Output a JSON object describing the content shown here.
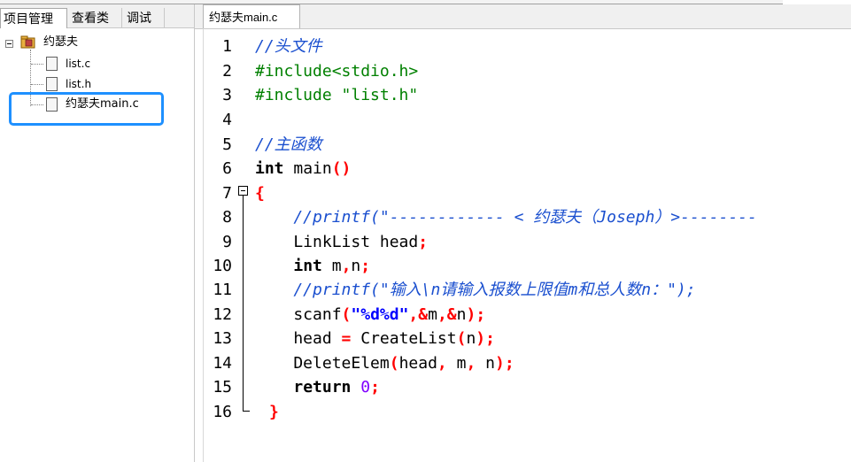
{
  "left_panel": {
    "tabs": [
      {
        "label": "项目管理",
        "active": true
      },
      {
        "label": "查看类",
        "active": false
      },
      {
        "label": "调试",
        "active": false
      }
    ],
    "tree": {
      "project": {
        "label": "约瑟夫",
        "icon": "project-folder-icon"
      },
      "files": [
        {
          "label": "list.c",
          "icon": "file-icon",
          "selected": false
        },
        {
          "label": "list.h",
          "icon": "file-icon",
          "selected": false
        },
        {
          "label": "约瑟夫main.c",
          "icon": "file-icon",
          "selected": true
        }
      ]
    }
  },
  "editor": {
    "tab_label": "约瑟夫main.c",
    "current_line": 16,
    "current_line_color": "#ccffff",
    "highlight_color": "#1e90ff",
    "line_numbers": [
      "1",
      "2",
      "3",
      "4",
      "5",
      "6",
      "7",
      "8",
      "9",
      "10",
      "11",
      "12",
      "13",
      "14",
      "15",
      "16"
    ],
    "code": {
      "l1": "//头文件",
      "l2": "#include<stdio.h>",
      "l3": "#include \"list.h\"",
      "l4": "",
      "l5": "//主函数",
      "l6_kw": "int",
      "l6_rest": " main",
      "l6_paren": "()",
      "l7": "{",
      "l8": "    //printf(\"------------ < 约瑟夫（Joseph）>--------",
      "l9_a": "    LinkList head",
      "l9_b": ";",
      "l10_kw": "int",
      "l10_rest": " m",
      "l10_comma": ",",
      "l10_n": "n",
      "l10_semi": ";",
      "l11": "    //printf(\"输入\\n请输入报数上限值m和总人数n：\");",
      "l12_a": "    scanf",
      "l12_p1": "(",
      "l12_str": "\"%d%d\"",
      "l12_c1": ",&",
      "l12_m": "m",
      "l12_c2": ",&",
      "l12_n": "n",
      "l12_end": ");",
      "l13_a": "    head ",
      "l13_eq": "=",
      "l13_b": " CreateList",
      "l13_p1": "(",
      "l13_n": "n",
      "l13_end": ");",
      "l14_a": "    DeleteElem",
      "l14_p1": "(",
      "l14_b": "head",
      "l14_c1": ",",
      "l14_m": " m",
      "l14_c2": ",",
      "l14_n": " n",
      "l14_end": ");",
      "l15_kw": "return",
      "l15_num": "0",
      "l15_semi": ";",
      "l16": "}"
    }
  }
}
